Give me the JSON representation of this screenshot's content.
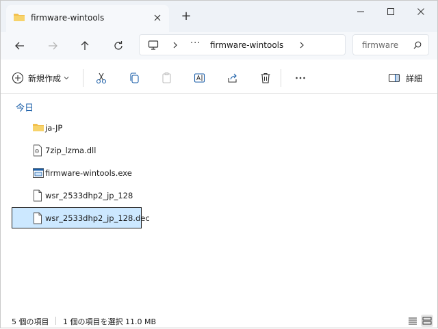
{
  "window": {
    "tab_title": "firmware-wintools",
    "new_tab_symbol": "+"
  },
  "address_bar": {
    "more": "···",
    "current_folder": "firmware-wintools"
  },
  "search": {
    "placeholder": "firmware"
  },
  "command_bar": {
    "new_label": "新規作成",
    "details_label": "詳細"
  },
  "content": {
    "group_header": "今日",
    "files": [
      {
        "name": "ja-JP",
        "icon": "folder-icon"
      },
      {
        "name": "7zip_lzma.dll",
        "icon": "dll-file-icon"
      },
      {
        "name": "firmware-wintools.exe",
        "icon": "exe-file-icon"
      },
      {
        "name": "wsr_2533dhp2_jp_128",
        "icon": "file-icon"
      },
      {
        "name": "wsr_2533dhp2_jp_128.dec",
        "icon": "file-icon",
        "selected": true
      }
    ]
  },
  "status": {
    "item_count": "5 個の項目",
    "selection": "1 個の項目を選択  11.0 MB"
  },
  "colors": {
    "accent": "#1a5ea8",
    "folder": "#f2c04f",
    "selection": "#cce8ff"
  }
}
